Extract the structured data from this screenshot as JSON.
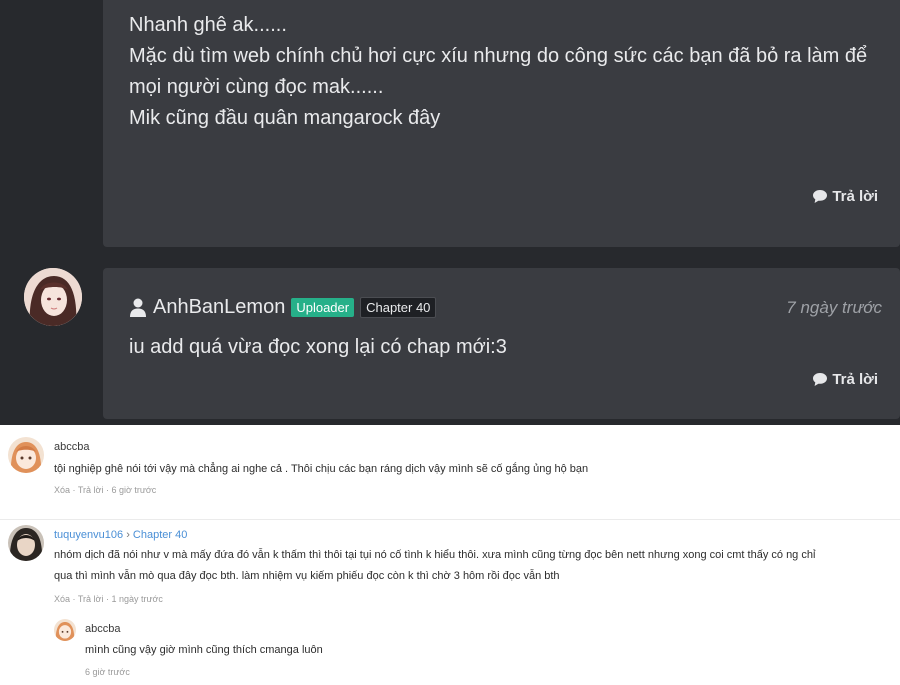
{
  "comment1": {
    "lines": [
      "Nhanh ghê ak......",
      "Mặc dù tìm web chính chủ hơi cực xíu nhưng do công sức các bạn đã bỏ ra làm để",
      "mọi người cùng đọc mak......",
      "Mik cũng đầu quân mangarock đây"
    ],
    "reply_label": "Trả lời"
  },
  "comment2": {
    "username": "AnhBanLemon",
    "badge_role": "Uploader",
    "badge_chapter": "Chapter 40",
    "time": "7 ngày trước",
    "text": "iu add quá vừa đọc xong lại có chap mới:3",
    "reply_label": "Trả lời"
  },
  "light_comments": [
    {
      "username": "abccba",
      "text": "tội nghiệp ghê nói tới vậy mà chẳng ai nghe cả . Thôi chịu các bạn ráng dịch vậy mình sẽ cố gắng ủng hộ bạn",
      "delete": "Xóa",
      "reply": "Trả lời",
      "time": "6 giờ trước"
    },
    {
      "username": "tuquyenvu106",
      "chapter": "Chapter 40",
      "text_lines": [
        "nhóm dịch đã nói như v mà mấy đứa đó vẫn k thấm thì thôi tại tụi nó cố tình k hiểu thôi. xưa mình cũng từng đọc bên nett nhưng xong coi cmt thấy có ng chỉ",
        "qua thì mình vẫn mò qua đây đọc bth. làm nhiệm vụ kiếm phiếu đọc còn k thì chờ 3 hôm rồi đọc vẫn bth"
      ],
      "delete": "Xóa",
      "reply": "Trả lời",
      "time": "1 ngày trước"
    },
    {
      "username": "abccba",
      "text": "mình cũng vậy giờ mình cũng thích cmanga luôn",
      "time": "6 giờ trước"
    }
  ],
  "colors": {
    "dark_bg": "#27292d",
    "card_bg": "#3a3c41",
    "uploader_badge": "#26b089",
    "link": "#4a8fd6"
  }
}
